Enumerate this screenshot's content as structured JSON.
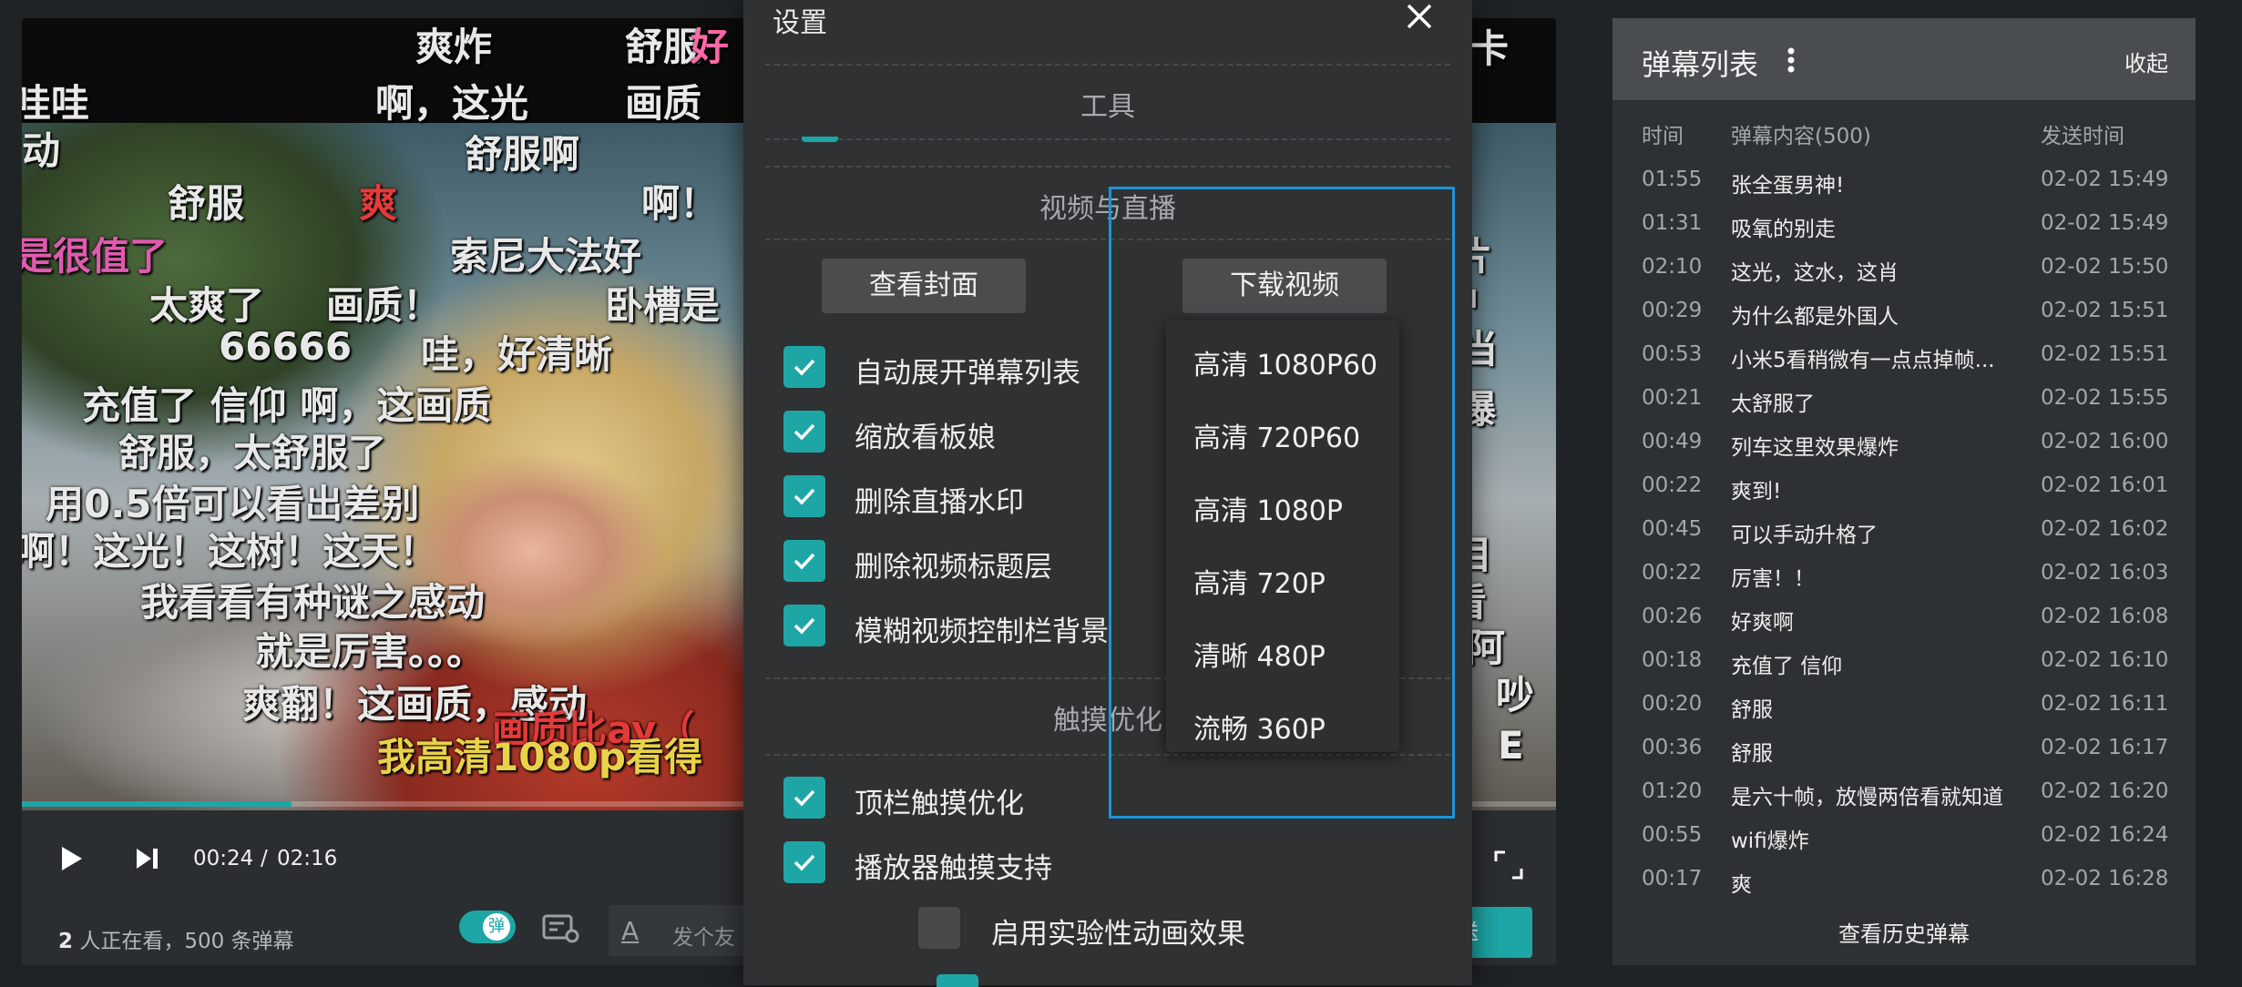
{
  "player": {
    "current_time": "00:24",
    "time_separator": "/",
    "total_time": "02:16",
    "progress_fraction": 0.176,
    "viewers_count": "2",
    "viewers_suffix": "人正在看，500 条弹幕",
    "danmaku_toggle_label": "弹",
    "send_placeholder": "发个友",
    "send_input_icon": "A",
    "send_button_label": "送"
  },
  "danmaku_overlay": [
    {
      "text": "爽炸",
      "color": "#e8e8e8"
    },
    {
      "text": "舒服",
      "color": "#e8e8e8"
    },
    {
      "text": "好",
      "color": "#ff6aa8"
    },
    {
      "text": "卡",
      "color": "#e8e8e8"
    },
    {
      "text": "哇哇",
      "color": "#e8e8e8"
    },
    {
      "text": "啊，这光",
      "color": "#e8e8e8"
    },
    {
      "text": "画质",
      "color": "#e8e8e8"
    },
    {
      "text": "动",
      "color": "#e8e8e8"
    },
    {
      "text": "舒服啊",
      "color": "#e8e8e8"
    },
    {
      "text": "舒服",
      "color": "#e8e8e8"
    },
    {
      "text": "爽",
      "color": "#e53a3a"
    },
    {
      "text": "啊！",
      "color": "#e8e8e8"
    },
    {
      "text": "是很值了",
      "color": "#e05ab0"
    },
    {
      "text": "索尼大法好",
      "color": "#e8e8e8"
    },
    {
      "text": "太爽了",
      "color": "#e8e8e8"
    },
    {
      "text": "画质！",
      "color": "#e8e8e8"
    },
    {
      "text": "卧槽是",
      "color": "#e8e8e8"
    },
    {
      "text": "66666",
      "color": "#e8e8e8"
    },
    {
      "text": "哇，好清晰",
      "color": "#e8e8e8"
    },
    {
      "text": "充值了 信仰 啊，这画质",
      "color": "#e8e8e8"
    },
    {
      "text": "舒服，太舒服了",
      "color": "#e8e8e8"
    },
    {
      "text": "用0.5倍可以看出差别",
      "color": "#e8e8e8"
    },
    {
      "text": "啊！这光！这树！这天！",
      "color": "#e8e8e8"
    },
    {
      "text": "我看看有种谜之感动",
      "color": "#e8e8e8"
    },
    {
      "text": "就是厉害。。。",
      "color": "#e8e8e8"
    },
    {
      "text": "爽翻！这画质，感动",
      "color": "#e8e8e8"
    },
    {
      "text": "画质比ay（",
      "color": "#e53a3a"
    },
    {
      "text": "我高清1080p看得",
      "color": "#e8d24a"
    },
    {
      "text": "大片",
      "color": "#e8e8e8"
    },
    {
      "text": "冲",
      "color": "#e8e8e8"
    },
    {
      "text": "担当",
      "color": "#e8e8e8"
    },
    {
      "text": "质爆",
      "color": "#e8e8e8"
    },
    {
      "text": "悦目",
      "color": "#e8e8e8"
    },
    {
      "text": "家看",
      "color": "#e8e8e8"
    },
    {
      "text": "阿",
      "color": "#e8e8e8"
    },
    {
      "text": "吵",
      "color": "#e8e8e8"
    },
    {
      "text": "E",
      "color": "#e8e8e8"
    }
  ],
  "settings": {
    "title": "设置",
    "section_tools": "工具",
    "section_video": "视频与直播",
    "view_cover_button": "查看封面",
    "download_video_button": "下载视频",
    "options": [
      {
        "label": "自动展开弹幕列表",
        "checked": true
      },
      {
        "label": "缩放看板娘",
        "checked": true
      },
      {
        "label": "删除直播水印",
        "checked": true
      },
      {
        "label": "删除视频标题层",
        "checked": true
      },
      {
        "label": "模糊视频控制栏背景",
        "checked": true
      }
    ],
    "section_touch": "触摸优化",
    "touch_options": [
      {
        "label": "顶栏触摸优化",
        "checked": true
      },
      {
        "label": "播放器触摸支持",
        "checked": true
      }
    ],
    "sub_options": [
      {
        "label": "启用实验性动画效果",
        "checked": false
      }
    ],
    "quality_options": [
      "高清 1080P60",
      "高清 720P60",
      "高清 1080P",
      "高清 720P",
      "清晰 480P",
      "流畅 360P"
    ]
  },
  "danmaku_list": {
    "title": "弹幕列表",
    "collapse_label": "收起",
    "col_time": "时间",
    "col_content": "弹幕内容(500)",
    "col_sent": "发送时间",
    "rows": [
      {
        "time": "01:55",
        "content": "张全蛋男神!",
        "sent": "02-02 15:49"
      },
      {
        "time": "01:31",
        "content": "吸氧的别走",
        "sent": "02-02 15:49"
      },
      {
        "time": "02:10",
        "content": "这光，这水，这肖",
        "sent": "02-02 15:50"
      },
      {
        "time": "00:29",
        "content": "为什么都是外国人",
        "sent": "02-02 15:51"
      },
      {
        "time": "00:53",
        "content": "小米5看稍微有一点点掉帧...",
        "sent": "02-02 15:51"
      },
      {
        "time": "00:21",
        "content": "太舒服了",
        "sent": "02-02 15:55"
      },
      {
        "time": "00:49",
        "content": "列车这里效果爆炸",
        "sent": "02-02 16:00"
      },
      {
        "time": "00:22",
        "content": "爽到!",
        "sent": "02-02 16:01"
      },
      {
        "time": "00:45",
        "content": "可以手动升格了",
        "sent": "02-02 16:02"
      },
      {
        "time": "00:22",
        "content": "厉害！！",
        "sent": "02-02 16:03"
      },
      {
        "time": "00:26",
        "content": "好爽啊",
        "sent": "02-02 16:08"
      },
      {
        "time": "00:18",
        "content": "充值了 信仰",
        "sent": "02-02 16:10"
      },
      {
        "time": "00:20",
        "content": "舒服",
        "sent": "02-02 16:11"
      },
      {
        "time": "00:36",
        "content": "舒服",
        "sent": "02-02 16:17"
      },
      {
        "time": "01:20",
        "content": "是六十帧，放慢两倍看就知道",
        "sent": "02-02 16:20"
      },
      {
        "time": "00:55",
        "content": "wifi爆炸",
        "sent": "02-02 16:24"
      },
      {
        "time": "00:17",
        "content": "爽",
        "sent": "02-02 16:28"
      }
    ],
    "history_button": "查看历史弹幕"
  },
  "colors": {
    "accent": "#1ea6a6",
    "highlight_border": "#1b95d8",
    "panel_bg": "#2e3133",
    "dialog_bg": "#2f3133"
  },
  "icons": [
    "play-icon",
    "next-icon",
    "fullscreen-icon",
    "danmaku-settings-icon",
    "close-icon",
    "more-vertical-icon",
    "checkmark-icon"
  ]
}
